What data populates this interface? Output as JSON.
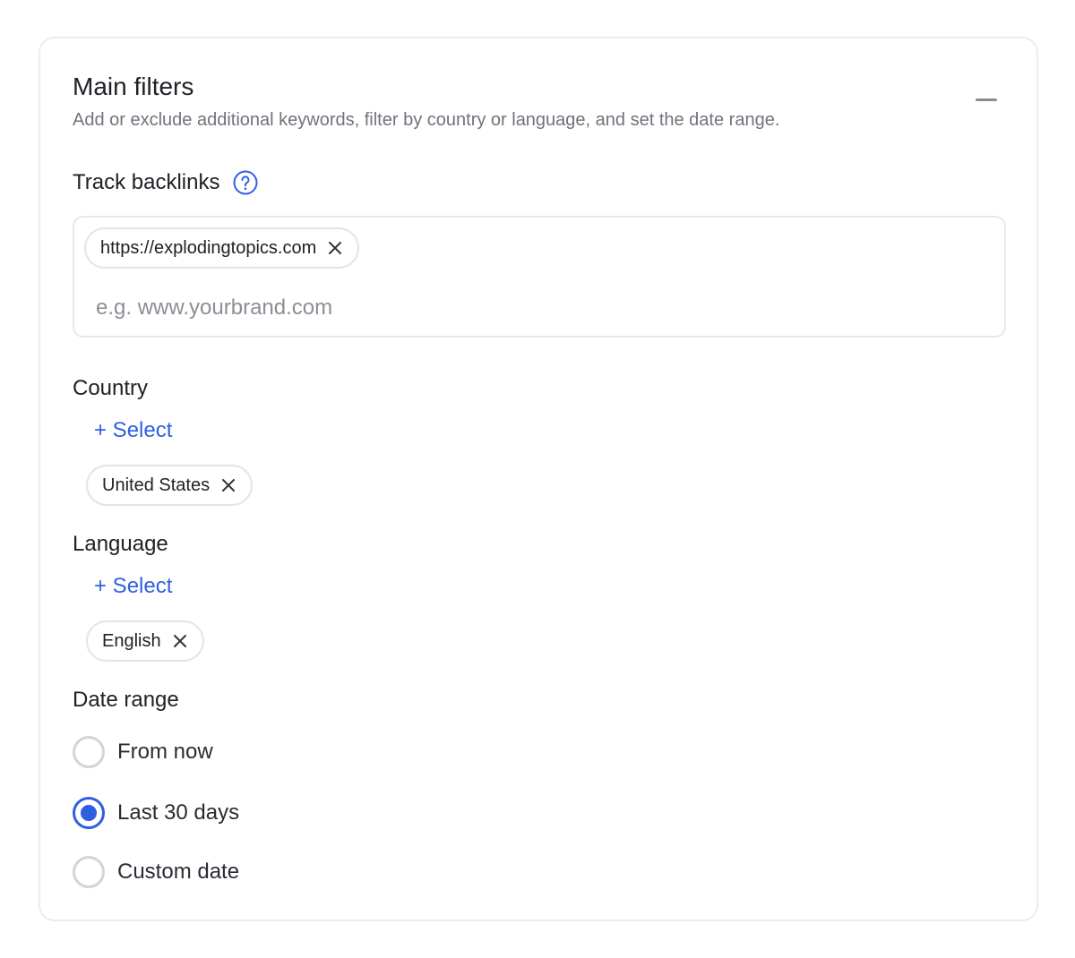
{
  "header": {
    "title": "Main filters",
    "subtitle": "Add or exclude additional keywords, filter by country or language, and set the date range."
  },
  "backlinks": {
    "label": "Track backlinks",
    "help_icon": "question-circle-icon",
    "tags": [
      "https://explodingtopics.com"
    ],
    "placeholder": "e.g. www.yourbrand.com",
    "value": ""
  },
  "country": {
    "label": "Country",
    "select_label": "+ Select",
    "selected": [
      "United States"
    ]
  },
  "language": {
    "label": "Language",
    "select_label": "+ Select",
    "selected": [
      "English"
    ]
  },
  "date_range": {
    "label": "Date range",
    "options": [
      {
        "label": "From now",
        "checked": false
      },
      {
        "label": "Last 30 days",
        "checked": true
      },
      {
        "label": "Custom date",
        "checked": false
      }
    ]
  },
  "colors": {
    "accent": "#2f5fe0",
    "border": "#ececf1",
    "muted_text": "#72727c"
  }
}
